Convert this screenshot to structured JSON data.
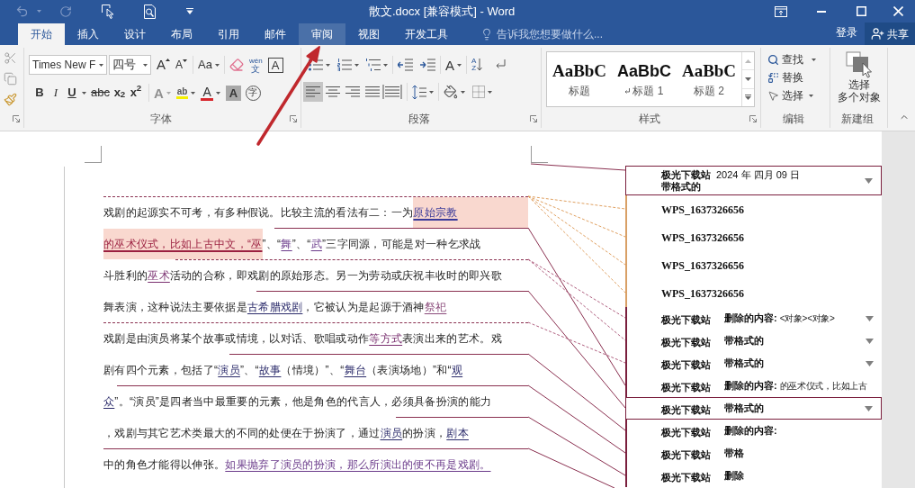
{
  "title_bar": {
    "title": "散文.docx [兼容模式] - Word"
  },
  "tabs": [
    {
      "label": "开始",
      "selected": true,
      "hover": false
    },
    {
      "label": "插入",
      "selected": false,
      "hover": false
    },
    {
      "label": "设计",
      "selected": false,
      "hover": false
    },
    {
      "label": "布局",
      "selected": false,
      "hover": false
    },
    {
      "label": "引用",
      "selected": false,
      "hover": false
    },
    {
      "label": "邮件",
      "selected": false,
      "hover": false
    },
    {
      "label": "审阅",
      "selected": false,
      "hover": true
    },
    {
      "label": "视图",
      "selected": false,
      "hover": false
    },
    {
      "label": "开发工具",
      "selected": false,
      "hover": false
    }
  ],
  "tell_me": {
    "placeholder": "告诉我您想要做什么..."
  },
  "account": {
    "sign_in": "登录",
    "share": "共享"
  },
  "ribbon": {
    "font": {
      "label": "字体",
      "font_name": "Times New F",
      "font_size": "四号",
      "grow": "A",
      "shrink": "A",
      "change_case": "Aa",
      "phonetic_ruby": "wén",
      "phonetic_base": "文",
      "char_border": "A",
      "format_buttons": [
        {
          "kind": "bold",
          "text": "B"
        },
        {
          "kind": "italic",
          "text": "I"
        },
        {
          "kind": "underline",
          "text": "U"
        },
        {
          "kind": "strike",
          "text": "abc"
        },
        {
          "kind": "subscript",
          "text": "x$_{2}$"
        },
        {
          "kind": "superscript",
          "text": "x$^{2}$"
        }
      ],
      "text_effects": "A",
      "highlight": "ab",
      "font_color": "A",
      "char_shading": "A",
      "enclose": "字"
    },
    "paragraph": {
      "label": "段落",
      "asian_layout": "A",
      "sort_top": "A",
      "sort_bottom": "Z",
      "alignments": [
        {
          "kind": "left",
          "selected": true
        },
        {
          "kind": "center",
          "selected": false
        },
        {
          "kind": "right",
          "selected": false
        },
        {
          "kind": "justify",
          "selected": false
        },
        {
          "kind": "distributed",
          "selected": false
        }
      ]
    },
    "styles": {
      "label": "样式",
      "items": [
        {
          "preview": "AaBbC",
          "name": "标题",
          "kind": "serif",
          "paragraph_mark": false
        },
        {
          "preview": "AaBbC",
          "name": "标题 1",
          "kind": "bold",
          "paragraph_mark": true
        },
        {
          "preview": "AaBbC",
          "name": "标题 2",
          "kind": "serif",
          "paragraph_mark": false
        }
      ]
    },
    "editing": {
      "label": "编辑",
      "find": "查找",
      "replace": "替换",
      "select": "选择"
    },
    "new_group": {
      "label": "新建组",
      "button_lines": [
        "选择",
        "多个对象"
      ]
    }
  },
  "document": {
    "lines": [
      {
        "segments": [
          {
            "text": "戏剧的起源实不可考，有多种假说。比较主流的看法有二：一为",
            "kind": "plain"
          },
          {
            "text": "原始宗教",
            "kind": "highlighted",
            "color": "#3a3a9a"
          }
        ]
      },
      {
        "segments": [
          {
            "text": "的巫术仪式，比如上古中文，“巫",
            "kind": "highlighted",
            "color": "#9b2040"
          },
          {
            "text": "”、“",
            "kind": "plain"
          },
          {
            "text": "舞",
            "kind": "marked",
            "color": "#6a3a8a"
          },
          {
            "text": "”、“",
            "kind": "plain"
          },
          {
            "text": "武",
            "kind": "marked",
            "color": "#6a3a8a"
          },
          {
            "text": "”三字同源，可能是对一种乞求战",
            "kind": "plain"
          }
        ]
      },
      {
        "segments": [
          {
            "text": "斗胜利的",
            "kind": "plain"
          },
          {
            "text": "巫术",
            "kind": "marked",
            "color": "#7a3070"
          },
          {
            "text": "活动的合称，即戏剧的原始形态。另一为劳动或庆祝丰收时的即兴歌",
            "kind": "plain"
          }
        ]
      },
      {
        "segments": [
          {
            "text": "舞表演，这种说法主要依据是",
            "kind": "plain"
          },
          {
            "text": "古希腊戏剧",
            "kind": "marked",
            "color": "#2a2a6a"
          },
          {
            "text": "，它被认为是起源于酒神",
            "kind": "plain"
          },
          {
            "text": "祭祀",
            "kind": "marked",
            "color": "#8a4a7a"
          }
        ]
      },
      {
        "segments": [
          {
            "text": "戏剧是由演员将某个故事或情境，以对话、歌唱或动作",
            "kind": "plain"
          },
          {
            "text": "等方式",
            "kind": "marked",
            "color": "#7a3070"
          },
          {
            "text": "表演出来的艺术。戏",
            "kind": "plain"
          }
        ]
      },
      {
        "segments": [
          {
            "text": "剧有四个元素，包括了“",
            "kind": "plain"
          },
          {
            "text": "演员",
            "kind": "marked",
            "color": "#2a2a6a"
          },
          {
            "text": "”、“",
            "kind": "plain"
          },
          {
            "text": "故事",
            "kind": "marked",
            "color": "#2a2a6a"
          },
          {
            "text": "（情境）”、“",
            "kind": "plain"
          },
          {
            "text": "舞台",
            "kind": "marked",
            "color": "#2a2a6a"
          },
          {
            "text": "（表演场地）”和“",
            "kind": "plain"
          },
          {
            "text": "观",
            "kind": "marked",
            "color": "#2a2a6a"
          }
        ]
      },
      {
        "segments": [
          {
            "text": "众",
            "kind": "marked",
            "color": "#2a2a6a"
          },
          {
            "text": "”。“演员”是四者当中最重要的元素，他是角色的代言人，必须具备扮演的能力",
            "kind": "plain"
          }
        ]
      },
      {
        "segments": [
          {
            "text": "，戏剧与其它艺术类最大的不同的处便在于扮演了，通过",
            "kind": "plain"
          },
          {
            "text": "演员",
            "kind": "marked",
            "color": "#2a2a6a"
          },
          {
            "text": "的扮演，",
            "kind": "plain"
          },
          {
            "text": "剧本",
            "kind": "marked",
            "color": "#2a2a6a"
          }
        ]
      },
      {
        "segments": [
          {
            "text": "中的角色才能得以伸张。",
            "kind": "plain"
          },
          {
            "text": "如果抛弃了演员的扮演，那么所演出的便不再是戏剧。",
            "kind": "marked",
            "color": "#6a3a8a"
          }
        ]
      }
    ]
  },
  "markup_pane": {
    "balloons": [
      {
        "kind": "header",
        "author": "极光下载站",
        "date": "2024 年 四月 09 日",
        "action": "带格式的",
        "outlined": true,
        "expandable": true,
        "color": "#7a1f3d"
      },
      {
        "kind": "author",
        "author": "WPS_1637326656",
        "outlined": false,
        "expandable": false,
        "color": "#d9a066"
      },
      {
        "kind": "author",
        "author": "WPS_1637326656",
        "outlined": false,
        "expandable": false,
        "color": "#d9a066"
      },
      {
        "kind": "author",
        "author": "WPS_1637326656",
        "outlined": false,
        "expandable": false,
        "color": "#d9a066"
      },
      {
        "kind": "author",
        "author": "WPS_1637326656",
        "outlined": false,
        "expandable": false,
        "color": "#d9a066"
      },
      {
        "kind": "row",
        "author": "极光下载站",
        "action": "删除的内容:",
        "content": "<对象><对象>",
        "outlined": false,
        "expandable": true,
        "color": "#7a1f3d"
      },
      {
        "kind": "row",
        "author": "极光下载站",
        "action": "带格式的",
        "outlined": false,
        "expandable": true,
        "color": "#7a1f3d"
      },
      {
        "kind": "row",
        "author": "极光下载站",
        "action": "带格式的",
        "outlined": false,
        "expandable": true,
        "color": "#7a1f3d"
      },
      {
        "kind": "row",
        "author": "极光下载站",
        "action": "删除的内容:",
        "content": "的巫术仪式，比如上古",
        "outlined": false,
        "expandable": false,
        "color": "#7a1f3d"
      },
      {
        "kind": "row",
        "author": "极光下载站",
        "action": "带格式的",
        "outlined": true,
        "expandable": true,
        "color": "#7a1f3d"
      },
      {
        "kind": "row",
        "author": "极光下载站",
        "action": "删除的内容:",
        "outlined": false,
        "expandable": false,
        "color": "#7a1f3d"
      },
      {
        "kind": "row",
        "author": "极光下载站",
        "action": "带格",
        "outlined": false,
        "expandable": false,
        "color": "#7a1f3d"
      },
      {
        "kind": "row",
        "author": "极光下载站",
        "action": "删除",
        "outlined": false,
        "expandable": false,
        "color": "#7a1f3d"
      }
    ]
  }
}
